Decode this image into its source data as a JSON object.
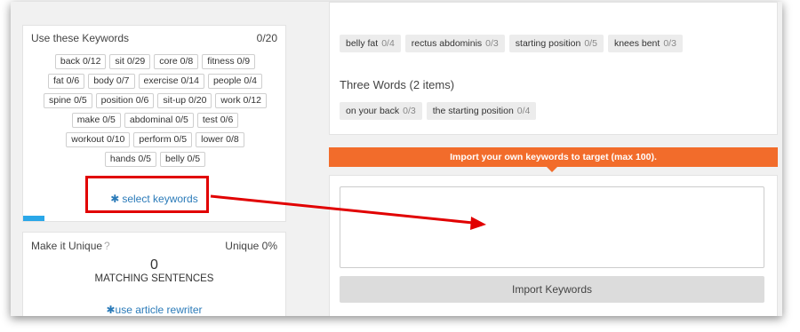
{
  "keywords_panel": {
    "title": "Use these Keywords",
    "score": "0/20",
    "rows": [
      [
        {
          "word": "back",
          "count": "0/12"
        },
        {
          "word": "sit",
          "count": "0/29"
        },
        {
          "word": "core",
          "count": "0/8"
        },
        {
          "word": "fitness",
          "count": "0/9"
        }
      ],
      [
        {
          "word": "fat",
          "count": "0/6"
        },
        {
          "word": "body",
          "count": "0/7"
        },
        {
          "word": "exercise",
          "count": "0/14"
        },
        {
          "word": "people",
          "count": "0/4"
        }
      ],
      [
        {
          "word": "spine",
          "count": "0/5"
        },
        {
          "word": "position",
          "count": "0/6"
        },
        {
          "word": "sit-up",
          "count": "0/20"
        },
        {
          "word": "work",
          "count": "0/12"
        }
      ],
      [
        {
          "word": "make",
          "count": "0/5"
        },
        {
          "word": "abdominal",
          "count": "0/5"
        },
        {
          "word": "test",
          "count": "0/6"
        }
      ],
      [
        {
          "word": "workout",
          "count": "0/10"
        },
        {
          "word": "perform",
          "count": "0/5"
        },
        {
          "word": "lower",
          "count": "0/8"
        }
      ],
      [
        {
          "word": "hands",
          "count": "0/5"
        },
        {
          "word": "belly",
          "count": "0/5"
        }
      ]
    ],
    "select_link": "select keywords",
    "progress": 0.08
  },
  "unique_panel": {
    "title": "Make it Unique",
    "help": "?",
    "score": "Unique 0%",
    "matching_count": "0",
    "matching_label": "MATCHING SENTENCES",
    "rewriter_link": "use article rewriter"
  },
  "two_words": {
    "items": [
      {
        "word": "belly fat",
        "count": "0/4"
      },
      {
        "word": "rectus abdominis",
        "count": "0/3"
      },
      {
        "word": "starting position",
        "count": "0/5"
      },
      {
        "word": "knees bent",
        "count": "0/3"
      }
    ]
  },
  "three_words": {
    "title": "Three Words (2 items)",
    "items": [
      {
        "word": "on your back",
        "count": "0/3"
      },
      {
        "word": "the starting position",
        "count": "0/4"
      }
    ]
  },
  "import": {
    "banner": "Import your own keywords to target (max 100).",
    "textarea_value": "",
    "button": "Import Keywords"
  },
  "colors": {
    "accent_orange": "#f26c2b",
    "link_blue": "#2b7bb9",
    "annotation_red": "#e10000"
  },
  "icons": {
    "gear": "gear-icon",
    "help": "question-icon"
  }
}
